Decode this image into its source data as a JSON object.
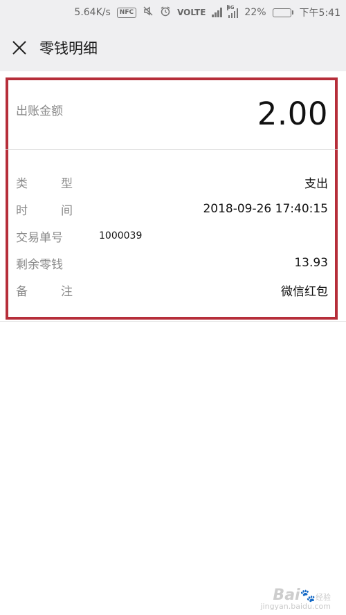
{
  "status_bar": {
    "speed": "5.64K/s",
    "nfc": "NFC",
    "volte": "VOLTE",
    "network_tag": "4G",
    "battery_percent": "22%",
    "battery_level": 0.22,
    "time": "下午5:41",
    "icons": [
      "nfc-icon",
      "mute-icon",
      "alarm-icon",
      "signal-icon",
      "battery-icon"
    ]
  },
  "appbar": {
    "title": "零钱明细",
    "close_icon": "close-icon"
  },
  "detail": {
    "amount_label": "出账金额",
    "amount_value": "2.00",
    "rows": [
      {
        "label": "类型",
        "value": "支出"
      },
      {
        "label": "时间",
        "value": "2018-09-26 17:40:15"
      },
      {
        "label": "交易单号",
        "value": "1000039"
      },
      {
        "label": "剩余零钱",
        "value": "13.93"
      },
      {
        "label": "备注",
        "value": "微信红包"
      }
    ]
  },
  "colors": {
    "highlight_border": "#b62e3a",
    "battery_fill": "#3fbf3f",
    "label_gray": "#8a8a8a"
  },
  "watermark": {
    "brand": "Bai",
    "brand_cn": "经验",
    "url": "jingyan.baidu.com"
  }
}
